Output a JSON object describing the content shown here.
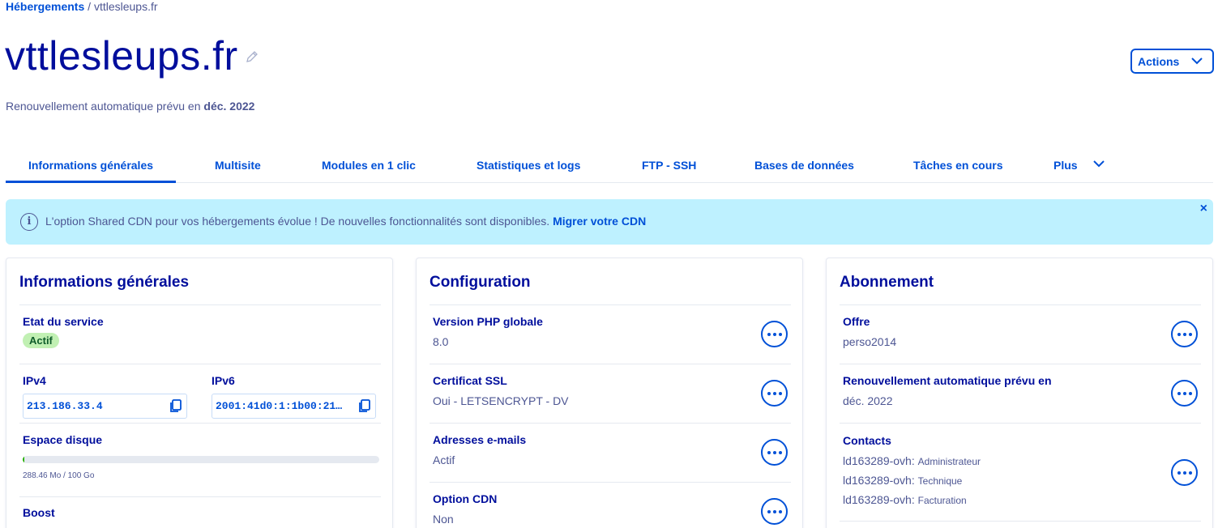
{
  "breadcrumb": {
    "parent": "Hébergements",
    "separator": " / ",
    "current": "vttlesleups.fr"
  },
  "header": {
    "title": "vttlesleups.fr",
    "renewal_prefix": "Renouvellement automatique prévu en ",
    "renewal_date": "déc. 2022",
    "actions_label": "Actions"
  },
  "tabs": [
    {
      "label": "Informations générales",
      "active": true
    },
    {
      "label": "Multisite"
    },
    {
      "label": "Modules en 1 clic"
    },
    {
      "label": "Statistiques et logs"
    },
    {
      "label": "FTP - SSH"
    },
    {
      "label": "Bases de données"
    },
    {
      "label": "Tâches en cours"
    },
    {
      "label": "Plus"
    }
  ],
  "banner": {
    "message": "L'option Shared CDN pour vos hébergements évolue ! De nouvelles fonctionnalités sont disponibles. ",
    "link": "Migrer votre CDN",
    "close": "×"
  },
  "general": {
    "title": "Informations générales",
    "state_label": "Etat du service",
    "state_value": "Actif",
    "ipv4_label": "IPv4",
    "ipv4_value": "213.186.33.4",
    "ipv6_label": "IPv6",
    "ipv6_value": "2001:41d0:1:1b00:21…",
    "disk_label": "Espace disque",
    "disk_text": "288.46 Mo / 100 Go",
    "disk_fraction": 0.0029,
    "boost_label": "Boost"
  },
  "configuration": {
    "title": "Configuration",
    "rows": [
      {
        "label": "Version PHP globale",
        "value": "8.0"
      },
      {
        "label": "Certificat SSL",
        "value": "Oui - LETSENCRYPT - DV"
      },
      {
        "label": "Adresses e-mails",
        "value": "Actif"
      },
      {
        "label": "Option CDN",
        "value": "Non"
      }
    ]
  },
  "subscription": {
    "title": "Abonnement",
    "offer_label": "Offre",
    "offer_value": "perso2014",
    "renewal_label": "Renouvellement automatique prévu en",
    "renewal_value": "déc. 2022",
    "contacts_label": "Contacts",
    "contacts": [
      {
        "id": "ld163289-ovh:",
        "role": "Administrateur"
      },
      {
        "id": "ld163289-ovh:",
        "role": "Technique"
      },
      {
        "id": "ld163289-ovh:",
        "role": "Facturation"
      }
    ]
  },
  "colors": {
    "primary": "#0050d7",
    "title": "#000e9c",
    "text": "#4d5693",
    "banner": "#bef1ff",
    "success": "#c1f0b3"
  }
}
